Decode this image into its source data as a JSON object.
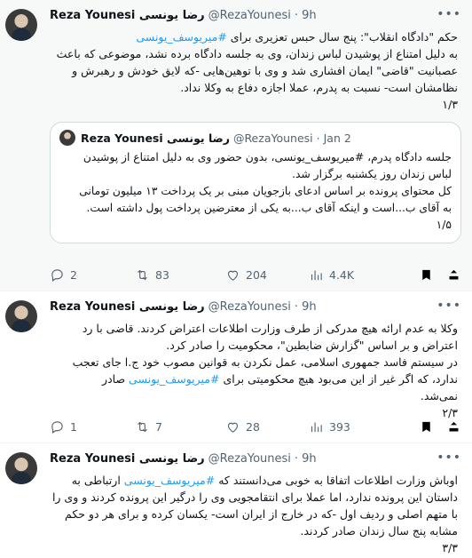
{
  "tweets": [
    {
      "name": "Reza Younesi رضا یونسی",
      "handle": "@RezaYounesi",
      "dot": "·",
      "time": "9h",
      "lines": [
        "حکم \"دادگاه انقلاب\": پنج سال حبس تعزیری برای ",
        "به دلیل امتناع از پوشیدن لباس زندان، وی به جلسه دادگاه برده نشد، موضوعی که باعث",
        "عصبانیت \"قاضی\" ایمان افشاری شد و وی با توهین‌هایی -که لایق خودش و رهبرش و",
        "نظامشان است- نسبت به پدرم، عملا اجازه دفاع به وکلا نداد.",
        "۱/۳"
      ],
      "hashtag": "#میریوسف_یونسی",
      "quote": {
        "name": "Reza Younesi رضا یونسی",
        "handle": "@RezaYounesi",
        "dot": "·",
        "time": "Jan 2",
        "lines": [
          "جلسه دادگاه پدرم، #میریوسف_یونسی، بدون حضور وی به دلیل امتناع از پوشیدن",
          "لباس زندان روز یکشنبه برگزار شد.",
          "کل محتوای پرونده بر اساس ادعای بازجویان مبنی بر یک پرداخت ۱۳ میلیون تومانی",
          "به آقای ب...است و اینکه آقای ب...به یکی از معترضین پرداخت پول داشته است.",
          "۱/۵"
        ]
      },
      "replies": "2",
      "retweets": "83",
      "likes": "204",
      "views": "4.4K"
    },
    {
      "name": "Reza Younesi رضا یونسی",
      "handle": "@RezaYounesi",
      "dot": "·",
      "time": "9h",
      "lines": [
        "وکلا به عدم ارائه هیچ مدرکی از طرف وزارت اطلاعات اعتراض کردند. قاضی با رد",
        "اعتراض و بر اساس \"گزارش ضابطین\"، محکومیت را صادر کرد.",
        "در سیستم فاسد جمهوری اسلامی، عمل نکردن به قوانین مصوب خود ج.ا جای تعجب",
        "ندارد، که اگر غیر از این می‌بود هیچ محکومیتی برای ",
        "نمی‌شد.",
        "۲/۳"
      ],
      "hashtag": "#میریوسف_یونسی",
      "line4_suffix": " صادر",
      "replies": "1",
      "retweets": "7",
      "likes": "28",
      "views": "393"
    },
    {
      "name": "Reza Younesi رضا یونسی",
      "handle": "@RezaYounesi",
      "dot": "·",
      "time": "9h",
      "lines": [
        "اوباش وزارت اطلاعات اتفاقا به خوبی می‌دانستند که ",
        "داستان این پرونده ندارد، اما عملا برای انتقامجویی وی را درگیر این پرونده کردند و وی را",
        "با متهم اصلی و ردیف اول -که در خارج از ایران است- یکسان کرده و برای هر دو حکم",
        "مشابه پنج سال زندان صادر کردند.",
        "۳/۳"
      ],
      "hashtag": "#میریوسف_یونسی",
      "line1_suffix": " ارتباطی به"
    }
  ]
}
